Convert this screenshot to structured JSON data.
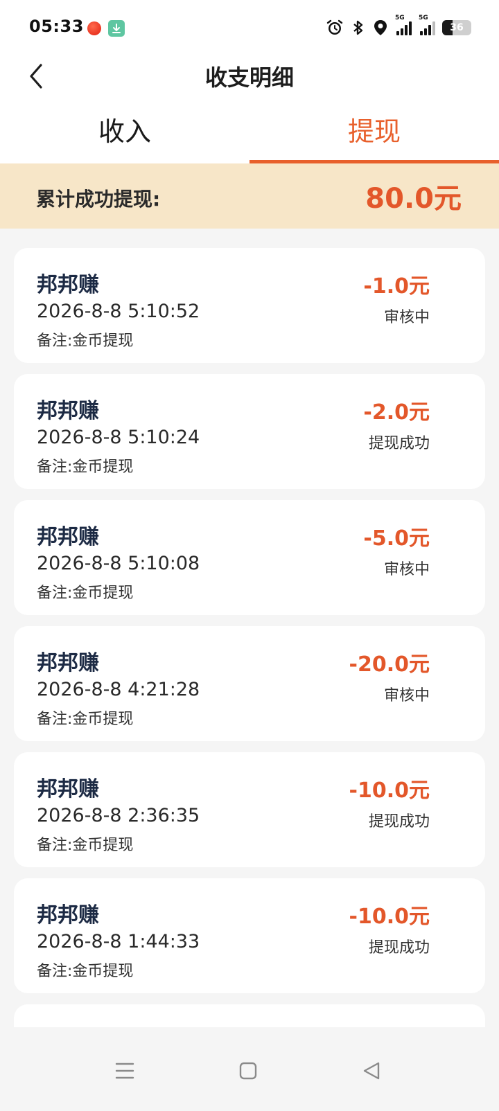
{
  "status_bar": {
    "time": "05:33",
    "network_1": "5G",
    "network_2": "5G",
    "battery_level": "36"
  },
  "header": {
    "title": "收支明细"
  },
  "tabs": [
    {
      "label": "收入",
      "active": false
    },
    {
      "label": "提现",
      "active": true
    }
  ],
  "summary": {
    "label": "累计成功提现:",
    "value": "80.0元"
  },
  "records": [
    {
      "app": "邦邦赚",
      "time": "2026-8-8 5:10:52",
      "note": "备注:金币提现",
      "amount": "-1.0元",
      "status": "审核中"
    },
    {
      "app": "邦邦赚",
      "time": "2026-8-8 5:10:24",
      "note": "备注:金币提现",
      "amount": "-2.0元",
      "status": "提现成功"
    },
    {
      "app": "邦邦赚",
      "time": "2026-8-8 5:10:08",
      "note": "备注:金币提现",
      "amount": "-5.0元",
      "status": "审核中"
    },
    {
      "app": "邦邦赚",
      "time": "2026-8-8 4:21:28",
      "note": "备注:金币提现",
      "amount": "-20.0元",
      "status": "审核中"
    },
    {
      "app": "邦邦赚",
      "time": "2026-8-8 2:36:35",
      "note": "备注:金币提现",
      "amount": "-10.0元",
      "status": "提现成功"
    },
    {
      "app": "邦邦赚",
      "time": "2026-8-8 1:44:33",
      "note": "备注:金币提现",
      "amount": "-10.0元",
      "status": "提现成功"
    }
  ],
  "colors": {
    "accent": "#e8602c",
    "amount": "#e3572a",
    "summary_bg": "#f7e6c8"
  },
  "icons": {
    "back": "chevron-left-icon",
    "menu": "menu-icon",
    "home": "home-square-icon",
    "nav_back": "triangle-back-icon"
  }
}
